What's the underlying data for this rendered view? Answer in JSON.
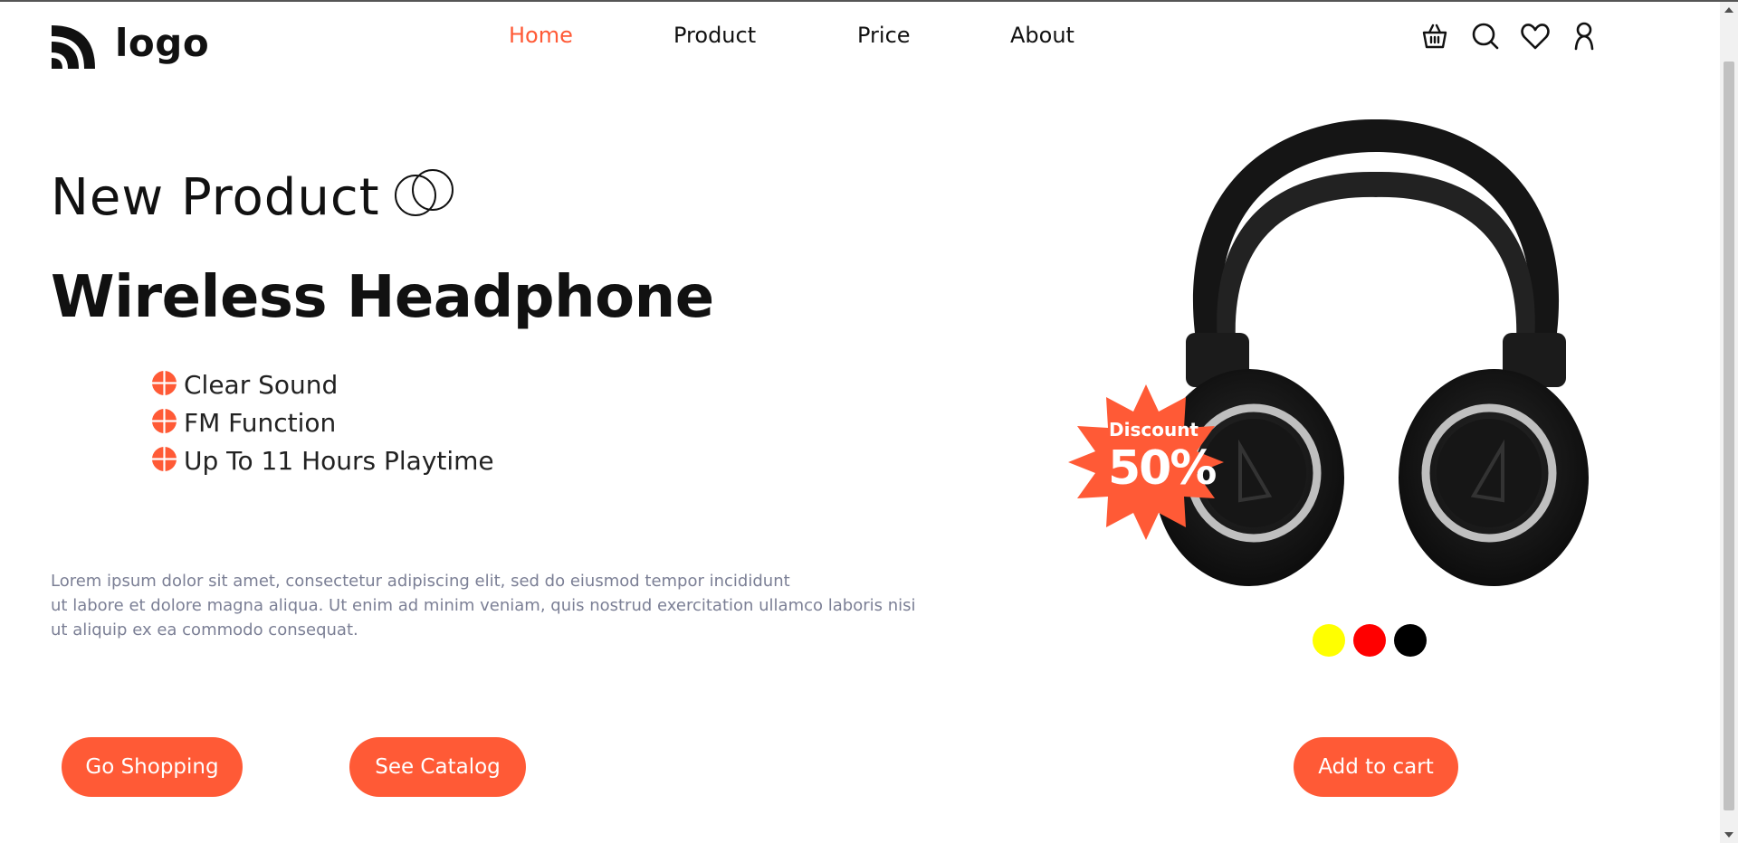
{
  "header": {
    "logo_text": "logo",
    "nav": [
      {
        "label": "Home",
        "active": true
      },
      {
        "label": "Product",
        "active": false
      },
      {
        "label": "Price",
        "active": false
      },
      {
        "label": "About",
        "active": false
      }
    ],
    "icons": [
      "basket-icon",
      "search-icon",
      "heart-icon",
      "user-icon"
    ]
  },
  "hero": {
    "subtitle": "New Product",
    "title": "Wireless Headphone",
    "features": [
      "Clear Sound",
      "FM Function",
      "Up To 11 Hours Playtime"
    ],
    "description_lines": [
      "Lorem ipsum dolor sit amet, consectetur adipiscing elit, sed do eiusmod tempor incididunt",
      "ut labore et dolore magna aliqua. Ut enim ad minim veniam, quis nostrud exercitation ullamco laboris nisi",
      "ut aliquip ex ea commodo consequat."
    ],
    "buttons": {
      "shop": "Go Shopping",
      "catalog": "See Catalog"
    }
  },
  "product": {
    "badge_label": "Discount",
    "badge_value": "50%",
    "colors": [
      "#ffff00",
      "#ff0000",
      "#000000"
    ],
    "add_to_cart": "Add to cart"
  },
  "theme": {
    "accent": "#ff5a36",
    "text": "#111111",
    "muted": "#7b7f95"
  }
}
